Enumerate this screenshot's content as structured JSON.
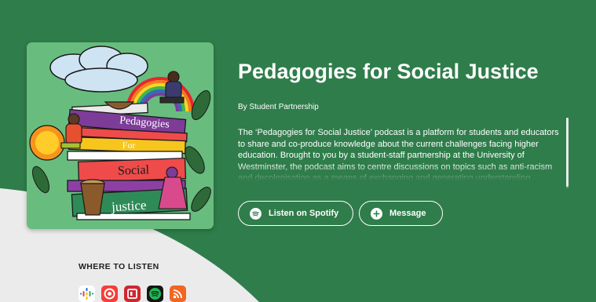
{
  "podcast": {
    "title": "Pedagogies for Social Justice",
    "author": "By Student Partnership",
    "description": "The ‘Pedagogies for Social Justice’ podcast is a platform for students and educators to share and co-produce knowledge about the current challenges facing higher education. Brought to you by a student-staff partnership at the University of Westminster, the podcast aims to centre discussions on topics such as anti-racism and decolonisation as a means of exchanging and generating understanding, perspectives and remedies."
  },
  "cover": {
    "book_titles": [
      "Pedagogies",
      "For",
      "Social",
      "justice"
    ]
  },
  "actions": {
    "spotify_label": "Listen on Spotify",
    "message_label": "Message"
  },
  "listen": {
    "heading": "WHERE TO LISTEN",
    "platforms": [
      {
        "name": "google-podcasts-icon",
        "color": "#ffffff"
      },
      {
        "name": "pocket-casts-icon",
        "color": "#f43e37"
      },
      {
        "name": "radiopublic-icon",
        "color": "#ce262f"
      },
      {
        "name": "spotify-icon",
        "color": "#191414"
      },
      {
        "name": "rss-icon",
        "color": "#f26522"
      }
    ]
  },
  "colors": {
    "background": "#2f7d4b",
    "light_area": "#ebebeb",
    "cover_background": "#68bd7e"
  }
}
